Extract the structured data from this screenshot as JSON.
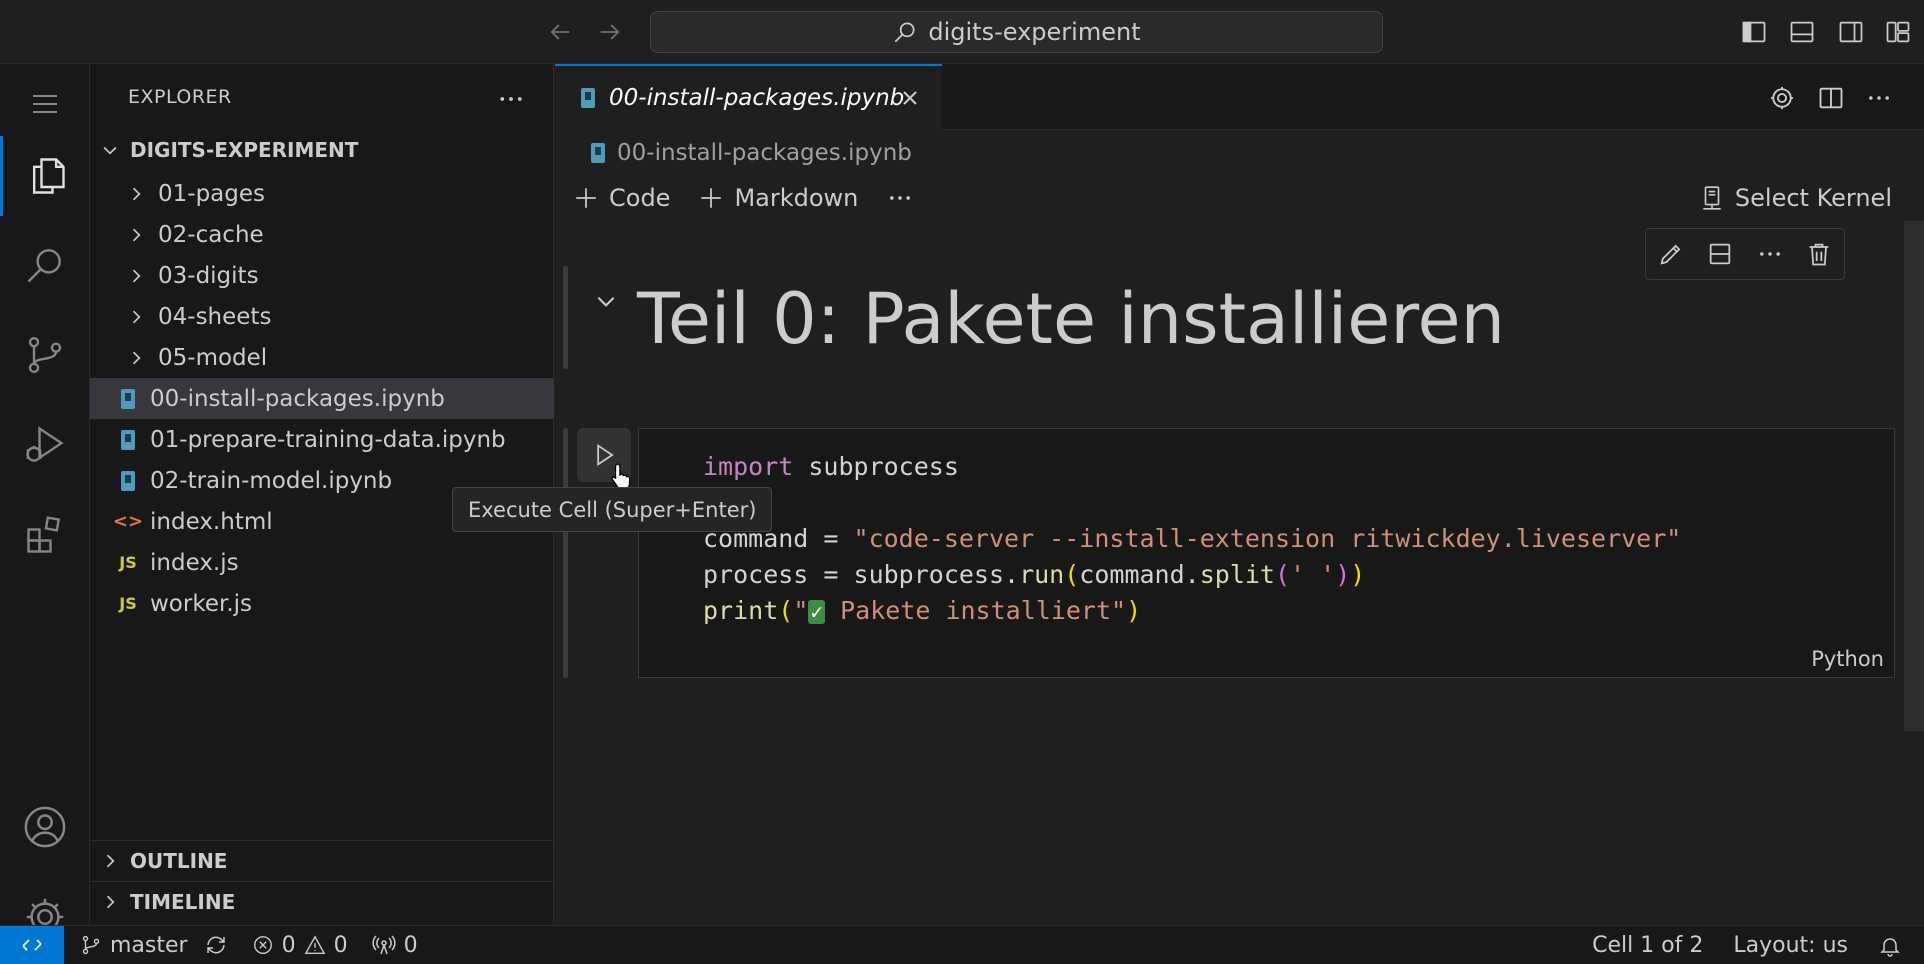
{
  "titlebar": {
    "search_text": "digits-experiment",
    "icons": [
      "arrow-left-icon",
      "arrow-right-icon",
      "search-icon",
      "toggle-primary-sidebar-icon",
      "toggle-panel-icon",
      "toggle-secondary-sidebar-icon",
      "customize-layout-icon"
    ]
  },
  "activity_bar": {
    "items": [
      "menu",
      "explorer",
      "search",
      "source-control",
      "run-and-debug",
      "extensions",
      "accounts",
      "manage"
    ]
  },
  "explorer": {
    "title": "EXPLORER",
    "root": "DIGITS-EXPERIMENT",
    "folders": [
      "01-pages",
      "02-cache",
      "03-digits",
      "04-sheets",
      "05-model"
    ],
    "files": [
      {
        "name": "00-install-packages.ipynb",
        "icon": "notebook-icon",
        "selected": true
      },
      {
        "name": "01-prepare-training-data.ipynb",
        "icon": "notebook-icon"
      },
      {
        "name": "02-train-model.ipynb",
        "icon": "notebook-icon"
      },
      {
        "name": "index.html",
        "icon": "html-icon",
        "glyph": "<>"
      },
      {
        "name": "index.js",
        "icon": "js-icon",
        "glyph": "JS"
      },
      {
        "name": "worker.js",
        "icon": "js-icon",
        "glyph": "JS"
      }
    ],
    "outline": "OUTLINE",
    "timeline": "TIMELINE"
  },
  "editor": {
    "tab_label": "00-install-packages.ipynb",
    "breadcrumb": "00-install-packages.ipynb",
    "toolbar": {
      "code_label": "Code",
      "markdown_label": "Markdown",
      "kernel_label": "Select Kernel"
    },
    "markdown_cell": {
      "heading": "Teil 0: Pakete installieren"
    },
    "code_cell": {
      "tooltip": "Execute Cell (Super+Enter)",
      "language": "Python",
      "line1_kw": "import",
      "line1_rest": " subprocess",
      "line3_var": "command = ",
      "line3_str": "\"code-server --install-extension ritwickdey.liveserver\"",
      "line4_a": "process = subprocess.",
      "line4_fn": "run",
      "line4_b": "command.",
      "line4_fn2": "split",
      "line4_str": "' '",
      "line5_fn": "print",
      "line5_q": "\"",
      "line5_check": "✓",
      "line5_str": " Pakete installiert\""
    }
  },
  "statusbar": {
    "branch": "master",
    "errors": "0",
    "warnings": "0",
    "ports": "0",
    "cell_position": "Cell 1 of 2",
    "layout": "Layout: us"
  }
}
